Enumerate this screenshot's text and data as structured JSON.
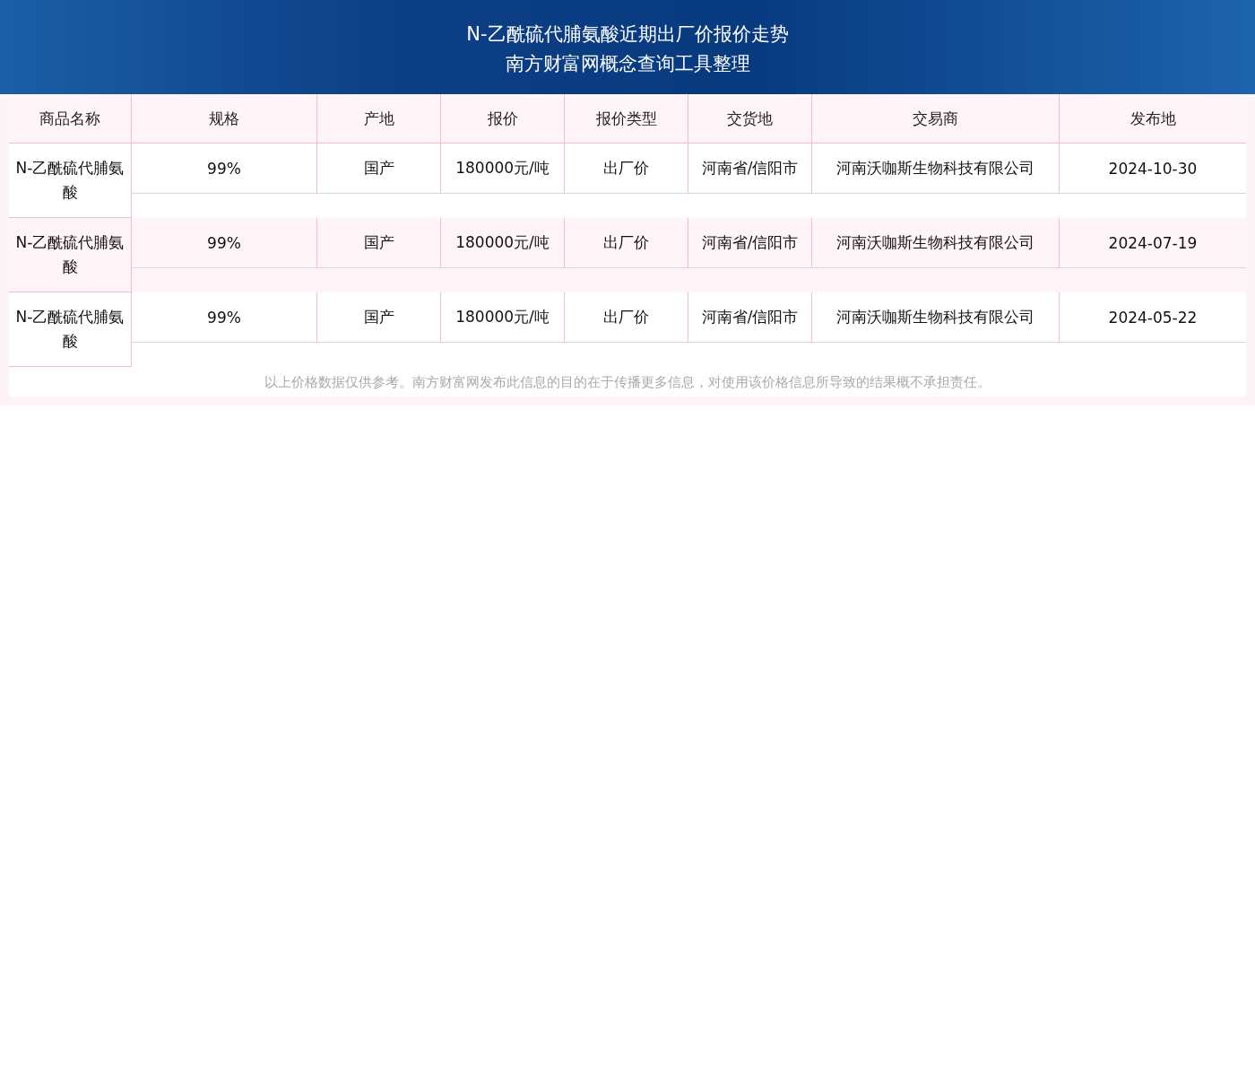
{
  "title_lines": [
    "N-乙酰硫代脯氨酸近期出厂价报价走势",
    "南方财富网概念查询工具整理"
  ],
  "table": {
    "columns": [
      "商品名称",
      "规格",
      "产地",
      "报价",
      "报价类型",
      "交货地",
      "交易商",
      "发布地"
    ],
    "rows": [
      [
        "N-乙酰硫代脯氨酸",
        "99%",
        "国产",
        "180000元/吨",
        "出厂价",
        "河南省/信阳市",
        "河南沃咖斯生物科技有限公司",
        "2024-10-30"
      ],
      [
        "N-乙酰硫代脯氨酸",
        "99%",
        "国产",
        "180000元/吨",
        "出厂价",
        "河南省/信阳市",
        "河南沃咖斯生物科技有限公司",
        "2024-07-19"
      ],
      [
        "N-乙酰硫代脯氨酸",
        "99%",
        "国产",
        "180000元/吨",
        "出厂价",
        "河南省/信阳市",
        "河南沃咖斯生物科技有限公司",
        "2024-05-22"
      ]
    ]
  },
  "disclaimer": "以上价格数据仅供参考。南方财富网发布此信息的目的在于传播更多信息，对使用该价格信息所导致的结果概不承担责任。"
}
